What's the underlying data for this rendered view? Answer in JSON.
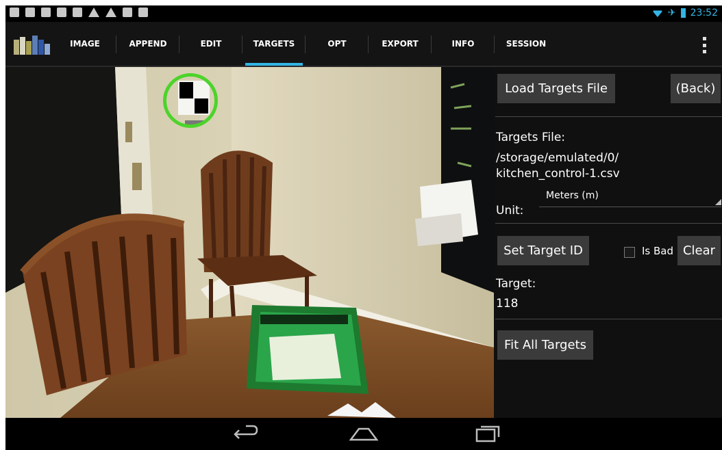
{
  "status_bar": {
    "time": "23:52",
    "notification_icons": [
      "app-icon",
      "image-icon",
      "clipboard-icon",
      "usb-icon",
      "photo-icon",
      "warning-icon",
      "warning-icon",
      "download-icon",
      "download-icon"
    ],
    "status_icons": [
      "wifi-icon",
      "airplane-mode-icon",
      "battery-icon"
    ]
  },
  "action_bar": {
    "tabs": [
      {
        "label": "IMAGE"
      },
      {
        "label": "APPEND"
      },
      {
        "label": "EDIT"
      },
      {
        "label": "TARGETS",
        "active": true
      },
      {
        "label": "OPT"
      },
      {
        "label": "EXPORT"
      },
      {
        "label": "INFO"
      },
      {
        "label": "SESSION"
      }
    ]
  },
  "panel": {
    "load_button": "Load Targets File",
    "back_button": "(Back)",
    "targets_file_label": "Targets File:",
    "targets_file_path_line1": "/storage/emulated/0/",
    "targets_file_path_line2": "kitchen_control-1.csv",
    "unit_label": "Unit:",
    "unit_value": "Meters (m)",
    "set_target_button": "Set Target ID",
    "is_bad_label": "Is Bad",
    "clear_button": "Clear",
    "target_label": "Target:",
    "target_value": "118",
    "fit_all_button": "Fit All Targets"
  },
  "nav_bar": {
    "buttons": [
      "back-icon",
      "home-icon",
      "recents-icon"
    ]
  },
  "colors": {
    "accent": "#33b5e5",
    "target_ring": "#4cd42a",
    "button_bg": "#3b3b3b",
    "panel_bg": "#101010"
  }
}
